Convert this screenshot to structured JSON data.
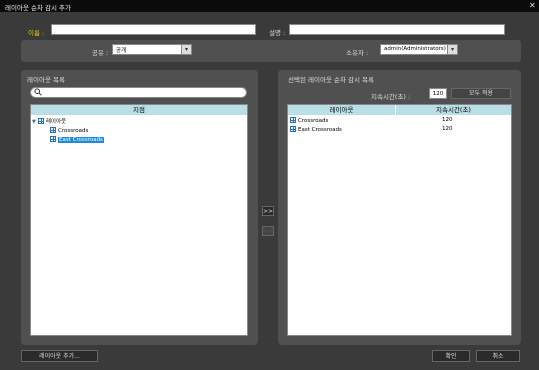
{
  "window": {
    "title": "레이아웃 순차 감시 추가"
  },
  "form": {
    "name_label": "이름 :",
    "name_value": "",
    "desc_label": "설명 :",
    "desc_value": "",
    "share_label": "공유 :",
    "share_value": "공개",
    "owner_label": "소유자 :",
    "owner_value": "admin(Administrators)"
  },
  "left_panel": {
    "title": "레이아웃 목록",
    "search_value": "",
    "column_header": "지점",
    "tree": {
      "root": "레이아웃",
      "items": [
        "Crossroads",
        "East Crossroads"
      ]
    }
  },
  "transfer": {
    "add_label": ">>",
    "remove_label": "<<"
  },
  "right_panel": {
    "title": "선택된 레이아웃 순차 감시 목록",
    "duration_label": "지속시간(초) :",
    "duration_value": "120",
    "apply_all_label": "모두 적용",
    "columns": [
      "레이아웃",
      "지속시간(초)"
    ],
    "rows": [
      {
        "name": "Crossroads",
        "duration": "120"
      },
      {
        "name": "East Crossroads",
        "duration": "120"
      }
    ]
  },
  "footer": {
    "add_layout_label": "레이아웃 추가...",
    "ok_label": "확인",
    "cancel_label": "취소"
  }
}
